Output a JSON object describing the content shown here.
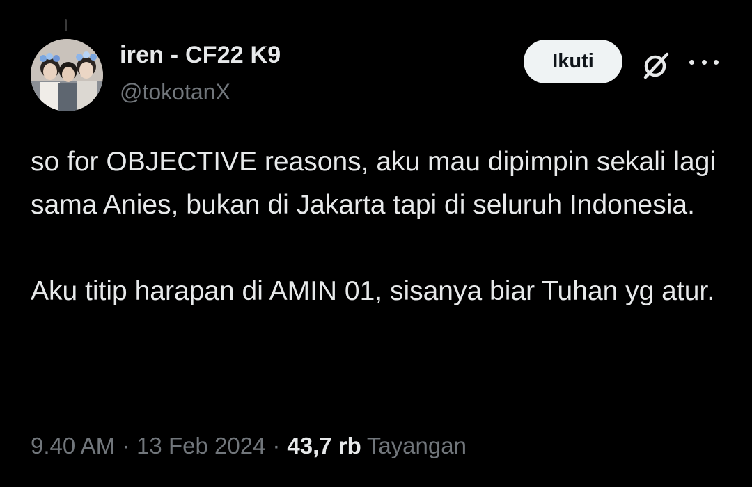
{
  "author": {
    "display_name": "iren - CF22 K9",
    "handle": "@tokotanX"
  },
  "actions": {
    "follow_label": "Ikuti",
    "grok_icon": "grok-icon",
    "more_icon": "more-icon"
  },
  "tweet": {
    "paragraphs": [
      "so for OBJECTIVE reasons, aku mau dipimpin sekali lagi sama Anies, bukan di Jakarta tapi di seluruh Indonesia.",
      "Aku titip harapan di AMIN 01, sisanya biar Tuhan yg atur."
    ]
  },
  "meta": {
    "time": "9.40 AM",
    "separator": "·",
    "date": "13 Feb 2024",
    "views_count": "43,7 rb",
    "views_label": "Tayangan"
  },
  "colors": {
    "background": "#000000",
    "primary_text": "#e7e9ea",
    "secondary_text": "#71767b",
    "follow_button_bg": "#eff3f4"
  }
}
